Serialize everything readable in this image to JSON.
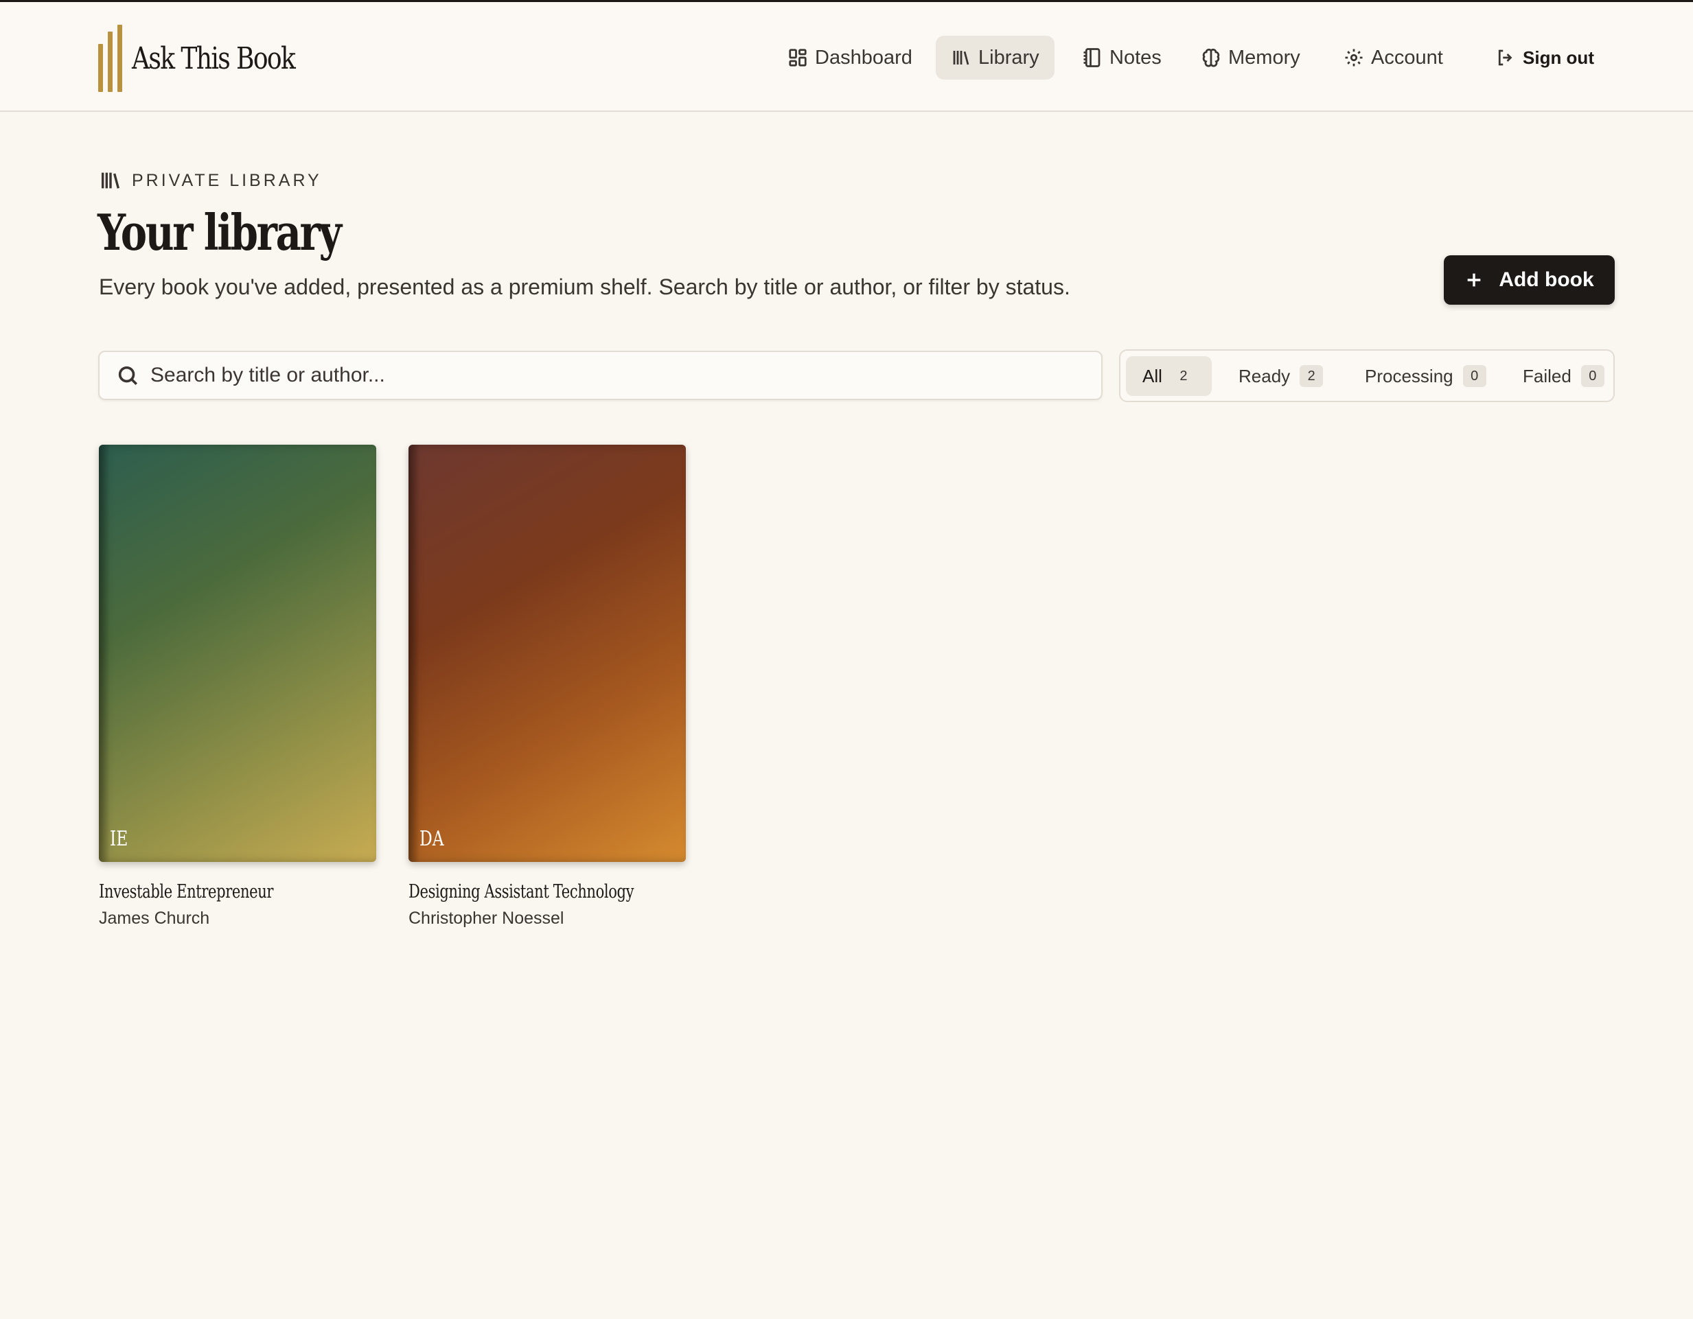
{
  "app": {
    "name": "Ask This Book"
  },
  "nav": {
    "items": [
      {
        "label": "Dashboard",
        "icon": "dashboard-icon"
      },
      {
        "label": "Library",
        "icon": "library-icon",
        "active": true
      },
      {
        "label": "Notes",
        "icon": "notebook-icon"
      },
      {
        "label": "Memory",
        "icon": "brain-icon"
      },
      {
        "label": "Account",
        "icon": "gear-icon"
      }
    ],
    "sign_out": "Sign out"
  },
  "header": {
    "eyebrow": "PRIVATE LIBRARY",
    "title": "Your library",
    "subtitle": "Every book you've added, presented as a premium shelf. Search by title or author, or filter by status.",
    "add_button": "Add book"
  },
  "search": {
    "placeholder": "Search by title or author...",
    "value": ""
  },
  "filters": [
    {
      "label": "All",
      "count": "2",
      "active": true
    },
    {
      "label": "Ready",
      "count": "2"
    },
    {
      "label": "Processing",
      "count": "0"
    },
    {
      "label": "Failed",
      "count": "0"
    }
  ],
  "books": [
    {
      "initials": "IE",
      "title": "Investable Entrepreneur",
      "author": "James Church",
      "cover_colors": [
        "#2d5e4f",
        "#c7ab52"
      ]
    },
    {
      "initials": "DA",
      "title": "Designing Assistant Technology",
      "author": "Christopher Noessel",
      "cover_colors": [
        "#6e3930",
        "#d58a2f"
      ]
    }
  ],
  "colors": {
    "accent": "#b8923f",
    "primary_button": "#1c1917",
    "background": "#faf6f0"
  }
}
